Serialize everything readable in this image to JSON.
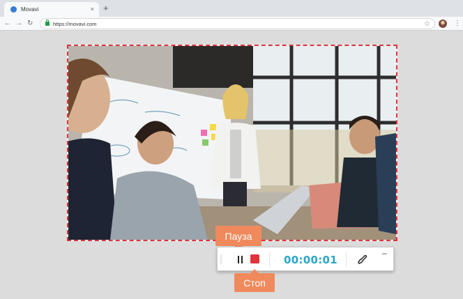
{
  "browser": {
    "tab_title": "Movavi",
    "tab_close": "×",
    "new_tab": "+",
    "url": "https://movavi.com",
    "back": "←",
    "forward": "→",
    "reload": "↻",
    "star": "☆",
    "menu": "⋮"
  },
  "recorder": {
    "timer": "00:00:01",
    "minimize": "–",
    "pause_tooltip": "Пауза",
    "stop_tooltip": "Стоп"
  },
  "colors": {
    "frame_dash": "#e0333c",
    "timer": "#2aa6c7",
    "stop": "#e0333c",
    "callout": "#f08a5d"
  },
  "icons": [
    "pause-icon",
    "stop-icon",
    "draw-icon",
    "minimize-icon",
    "drag-handle-icon"
  ]
}
